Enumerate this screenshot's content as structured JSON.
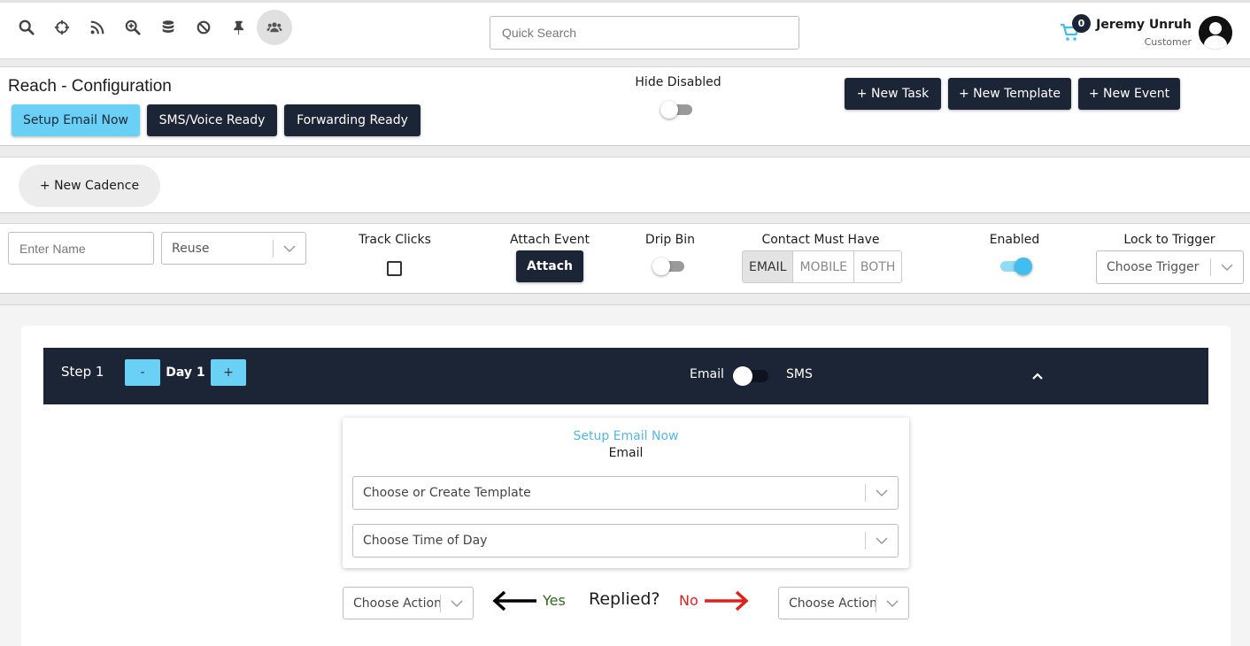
{
  "topbar": {
    "icons": [
      "search-icon",
      "crosshair-icon",
      "rss-icon",
      "zoom-in-icon",
      "database-icon",
      "ban-icon",
      "pin-icon",
      "users-icon"
    ],
    "search_placeholder": "Quick Search",
    "cart_count": "0",
    "user_name": "Jeremy Unruh",
    "user_role": "Customer"
  },
  "config": {
    "title": "Reach - Configuration",
    "setup_email_label": "Setup Email Now",
    "sms_voice_label": "SMS/Voice Ready",
    "forwarding_label": "Forwarding Ready",
    "hide_disabled_label": "Hide Disabled",
    "hide_disabled_on": false,
    "new_task_label": "+ New Task",
    "new_template_label": "+ New Template",
    "new_event_label": "+ New Event"
  },
  "cadence": {
    "new_cadence_label": "+ New Cadence"
  },
  "settings": {
    "name_placeholder": "Enter Name",
    "reuse_value": "Reuse",
    "track_clicks_label": "Track Clicks",
    "attach_event_label": "Attach Event",
    "attach_button": "Attach",
    "drip_bin_label": "Drip Bin",
    "contact_must_have_label": "Contact Must Have",
    "contact_options": [
      "EMAIL",
      "MOBILE",
      "BOTH"
    ],
    "contact_selected": "EMAIL",
    "enabled_label": "Enabled",
    "enabled_on": true,
    "lock_trigger_label": "Lock to Trigger",
    "trigger_value": "Choose Trigger"
  },
  "step": {
    "label": "Step 1",
    "minus": "-",
    "day": "Day 1",
    "plus": "+",
    "email_label": "Email",
    "sms_label": "SMS",
    "setup_link": "Setup Email Now",
    "channel_title": "Email",
    "template_value": "Choose or Create Template",
    "time_value": "Choose Time of Day",
    "left_action": "Choose Action",
    "yes_label": "Yes",
    "replied_label": "Replied?",
    "no_label": "No",
    "right_action": "Choose Action"
  },
  "colors": {
    "navy": "#1c2536",
    "accent_blue": "#6ad0f5",
    "link_blue": "#4fb8e6",
    "yes_green": "#2e6b1e",
    "no_red": "#e0201b"
  }
}
